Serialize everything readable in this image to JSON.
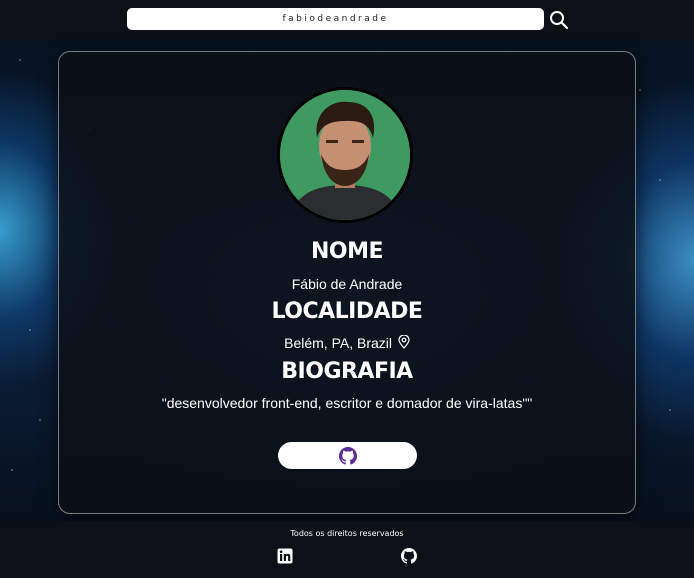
{
  "header": {
    "search_value": "fabiodeandrade",
    "search_icon": "search-icon"
  },
  "profile": {
    "avatar_alt": "profile-photo",
    "name_heading": "NOME",
    "name_value": "Fábio de Andrade",
    "location_heading": "LOCALIDADE",
    "location_value": "Belém, PA, Brazil",
    "location_icon": "map-pin-icon",
    "bio_heading": "BIOGRAFIA",
    "bio_value": "\"desenvolvedor front-end, escritor e domador de vira-latas\"\"",
    "github_button_icon": "github-icon",
    "accent_color": "#5b2a99"
  },
  "footer": {
    "text": "Todos os direitos reservados",
    "links": [
      "linkedin-icon",
      "github-icon"
    ]
  }
}
